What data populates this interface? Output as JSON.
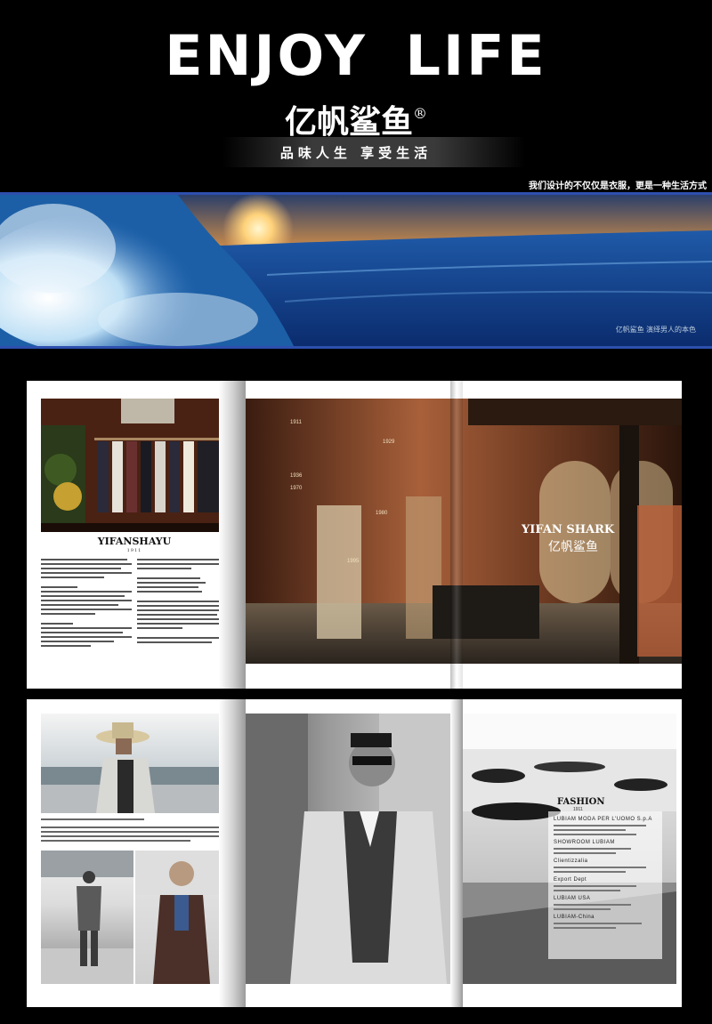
{
  "header": {
    "headline": "ENJOY  LIFE",
    "brand": "亿帆鲨鱼",
    "registered_mark": "®",
    "tagline": "品味人生  享受生活",
    "sub_slogan": "我们设计的不仅仅是衣服，更是一种生活方式"
  },
  "banner": {
    "caption": "亿帆鲨鱼 演绎男人的本色"
  },
  "spread1": {
    "left_title": "YIFANSHAYU",
    "left_subtitle": "1911",
    "right_title": "YIFAN SHARK",
    "right_subtitle": "亿帆鲨鱼",
    "years": [
      "1911",
      "1929",
      "1936",
      "1970",
      "1980",
      "1995"
    ]
  },
  "spread2": {
    "right_title": "FASHION",
    "right_subtitle": "1911",
    "contacts": [
      "LUBIAM MODA PER L'UOMO S.p.A",
      "SHOWROOM LUBIAM",
      "Clientizzalia",
      "Export Dept",
      "LUBIAM USA",
      "LUBIAM-China"
    ]
  },
  "colors": {
    "background": "#000000",
    "accent_blue": "#2d4fae",
    "page": "#ffffff"
  }
}
